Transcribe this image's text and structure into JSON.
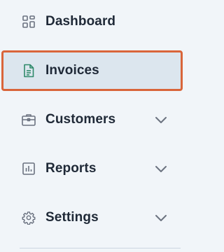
{
  "nav": {
    "items": [
      {
        "label": "Dashboard",
        "icon": "dashboard-icon",
        "has_chevron": false,
        "active": false
      },
      {
        "label": "Invoices",
        "icon": "invoice-icon",
        "has_chevron": false,
        "active": true
      },
      {
        "label": "Customers",
        "icon": "briefcase-icon",
        "has_chevron": true,
        "active": false
      },
      {
        "label": "Reports",
        "icon": "bar-chart-icon",
        "has_chevron": true,
        "active": false
      },
      {
        "label": "Settings",
        "icon": "gear-icon",
        "has_chevron": true,
        "active": false
      }
    ]
  },
  "colors": {
    "background": "#f1f5f9",
    "active_background": "#dce6ee",
    "active_border": "#d9653a",
    "active_icon": "#2f8a6a",
    "icon": "#6b7280",
    "text": "#1f2937"
  }
}
